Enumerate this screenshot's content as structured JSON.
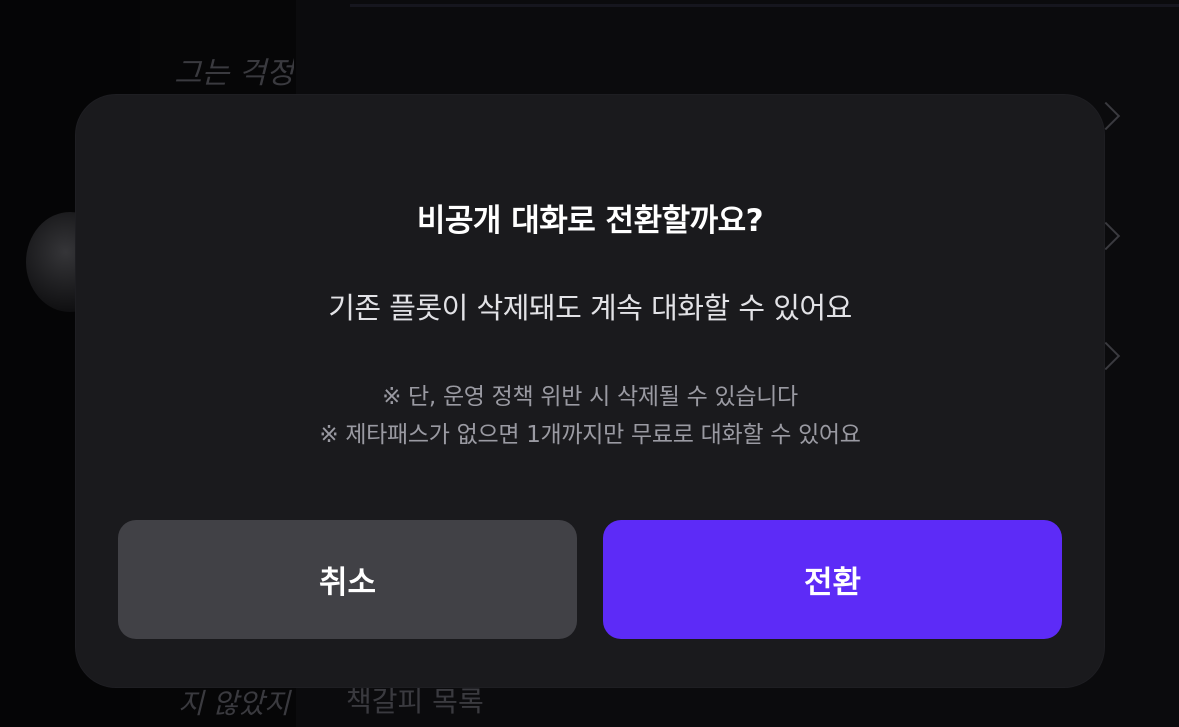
{
  "background": {
    "top_text": "그는 걱정",
    "bottom_left_text": "지 않았지",
    "bottom_text": "책갈피 목록"
  },
  "dialog": {
    "title": "비공개 대화로 전환할까요?",
    "description": "기존 플롯이 삭제돼도 계속 대화할 수 있어요",
    "notes": [
      "※ 단, 운영 정책 위반 시 삭제될 수 있습니다",
      "※ 제타패스가 없으면 1개까지만 무료로 대화할 수 있어요"
    ],
    "cancel_label": "취소",
    "confirm_label": "전환"
  },
  "colors": {
    "modal_bg": "#1a1a1d",
    "cancel_button": "#414146",
    "confirm_button": "#5d2bf7",
    "title_text": "#ffffff",
    "note_text": "#9a9aa2"
  },
  "icons": {
    "list_row": "chevron-right-icon"
  }
}
